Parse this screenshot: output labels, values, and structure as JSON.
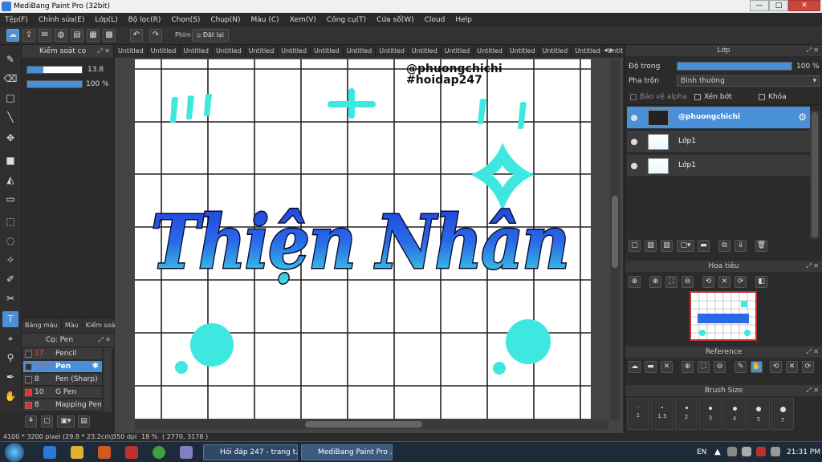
{
  "window": {
    "title": "MediBang Paint Pro (32bit)",
    "min": "—",
    "max": "□",
    "close": "✕"
  },
  "menu": [
    "Tệp(F)",
    "Chỉnh sửa(E)",
    "Lớp(L)",
    "Bộ lọc(R)",
    "Chọn(S)",
    "Chụp(N)",
    "Màu (C)",
    "Xem(V)",
    "Công cụ(T)",
    "Cửa sổ(W)",
    "Cloud",
    "Help"
  ],
  "toolbar": {
    "phim_label": "Phím",
    "reset_label": "Đặt lại"
  },
  "brush_control": {
    "title": "Kiểm soát cọ",
    "size": "13.8",
    "opacity": "100 %",
    "size_fraction": 0.3,
    "opacity_fraction": 1.0
  },
  "color_tabs": [
    "Bảng màu",
    "Màu",
    "Kiểm soát cọ"
  ],
  "brush_list": {
    "title": "Cọ: Pen",
    "items": [
      {
        "size": "17",
        "name": "Pencil",
        "color": "#333333",
        "size_color": "#e05050"
      },
      {
        "size": "13.8",
        "name": "Pen",
        "color": "#333333",
        "size_color": "#e05050",
        "selected": true
      },
      {
        "size": "8",
        "name": "Pen (Sharp)",
        "color": "#333333",
        "size_color": "#dddddd"
      },
      {
        "size": "10",
        "name": "G Pen",
        "color": "#e03030",
        "size_color": "#dddddd"
      },
      {
        "size": "8",
        "name": "Mapping Pen",
        "color": "#e03030",
        "size_color": "#dddddd"
      }
    ]
  },
  "tabs": [
    "Untitled",
    "Untitled",
    "Untitled",
    "Untitled",
    "Untitled",
    "Untitled",
    "Untitled",
    "Untitled",
    "Untitled",
    "Untitled",
    "Untitled",
    "Untitled",
    "Untitled",
    "Untitled",
    "Untitled",
    "Untitled",
    "Untitled"
  ],
  "canvas": {
    "watermark_handle": "@phuongchichi",
    "watermark_tag": "#hoidap247",
    "lettering": "Thiện Nhân",
    "accent_cyan": "#3ee8e0",
    "accent_blue": "#2244dd"
  },
  "layer_panel": {
    "title": "Lớp",
    "opacity_label": "Độ trong",
    "opacity_value": "100 %",
    "opacity_fraction": 1.0,
    "blend_label": "Pha trộn",
    "blend_value": "Bình thường",
    "protect_alpha": "Bảo vệ alpha",
    "clipping": "Xén bớt",
    "lock": "Khóa",
    "layers": [
      {
        "name": "@phuongchichi",
        "selected": true
      },
      {
        "name": "Lớp1"
      },
      {
        "name": "Lớp1"
      }
    ]
  },
  "navigator": {
    "title": "Hoa tiêu"
  },
  "reference": {
    "title": "Reference"
  },
  "brush_size": {
    "title": "Brush Size",
    "labels": [
      "1",
      "1.5",
      "2",
      "3",
      "4",
      "5",
      "7"
    ]
  },
  "status": {
    "dims": "4100 * 3200 pixel",
    "cm": "(29.8 * 23.2cm)",
    "dpi": "350 dpi",
    "zoom": "18 %",
    "coords": "( 2770, 3178 )"
  },
  "taskbar": {
    "items": [
      "Hỏi đáp 247 - trang t...",
      "MediBang Paint Pro ..."
    ],
    "lang": "EN",
    "time": "21:31 PM"
  }
}
